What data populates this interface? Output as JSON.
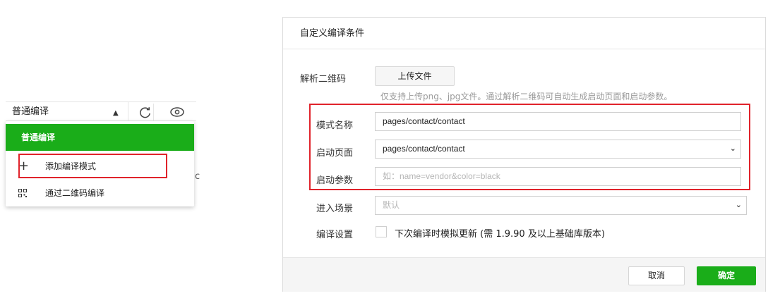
{
  "dropdown_panel": {
    "mode_select": {
      "value": "普通编译"
    },
    "items": [
      {
        "label": "普通编译",
        "active": true
      },
      {
        "label": "添加编译模式",
        "icon": "plus-icon"
      },
      {
        "label": "通过二维码编译",
        "icon": "qrcode-icon"
      }
    ],
    "stray_text": "c"
  },
  "dialog": {
    "title": "自定义编译条件",
    "qrcode": {
      "label": "解析二维码",
      "upload_label": "上传文件",
      "hint": "仅支持上传png、jpg文件。通过解析二维码可自动生成启动页面和启动参数。"
    },
    "mode_name": {
      "label": "模式名称",
      "value": "pages/contact/contact"
    },
    "start_page": {
      "label": "启动页面",
      "value": "pages/contact/contact"
    },
    "start_params": {
      "label": "启动参数",
      "placeholder": "如：name=vendor&color=black"
    },
    "scene": {
      "label": "进入场景",
      "value": "默认"
    },
    "compile_settings": {
      "label": "编译设置",
      "checkbox_label": "下次编译时模拟更新 (需 1.9.90 及以上基础库版本)",
      "checked": false
    },
    "cancel_label": "取消",
    "ok_label": "确定"
  },
  "colors": {
    "accent": "#1aad19",
    "highlight": "#e0232b"
  }
}
